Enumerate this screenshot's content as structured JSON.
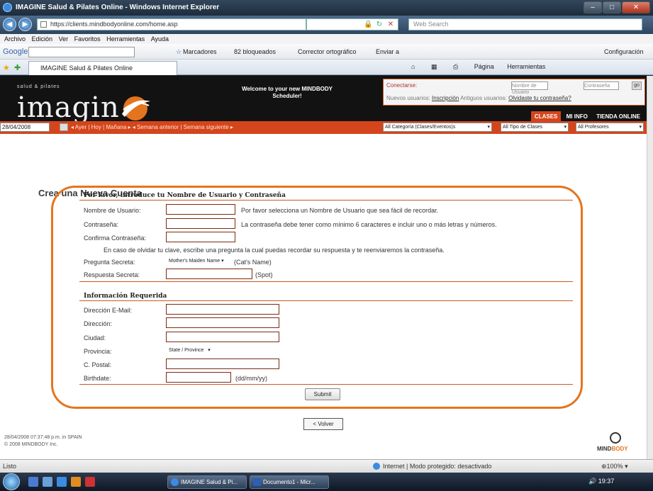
{
  "window": {
    "title": "IMAGINE Salud & Pilates Online - Windows Internet Explorer"
  },
  "address": {
    "url": "https://clients.mindbodyonline.com/home.asp",
    "search_placeholder": "Web Search"
  },
  "menu": [
    "Archivo",
    "Edición",
    "Ver",
    "Favoritos",
    "Herramientas",
    "Ayuda"
  ],
  "google_toolbar": {
    "logo": "Google",
    "marcadores": "Marcadores",
    "bloqueados": "82 bloqueados",
    "corrector": "Corrector ortográfico",
    "enviar": "Enviar a",
    "configuracion": "Configuración"
  },
  "tab": {
    "title": "IMAGINE Salud & Pilates Online",
    "tools": [
      "Página",
      "Herramientas"
    ]
  },
  "site": {
    "brand_small": "salud & pilates",
    "brand": "imagin",
    "welcome": "Welcome to your new MINDBODY Scheduler!",
    "login_label": "Conectarse:",
    "user_placeholder": "Nombre de Usuario",
    "pass_placeholder": "Contraseña",
    "go": "go",
    "new_users": "Nuevos usuarios:",
    "register": "Inscripción",
    "old_users": "Antiguos usuarios:",
    "forgot": "Olvidaste tu contraseña?",
    "nav": [
      "CLASES",
      "MI INFO",
      "TIENDA ONLINE"
    ],
    "date": "28/04/2008",
    "datenav": "◂ Ayer | Hoy | Mañana ▸  ◂ Semana anterior | Semana siguiente ▸",
    "filters": [
      "All Categoría (Clases/Eventos)s",
      "All Tipo de Clases",
      "All Profesores"
    ]
  },
  "form": {
    "title": "Crea una Nueva Cuenta",
    "section1": "Por favor, introduce tu Nombre de Usuario y Contraseña",
    "username_label": "Nombre de Usuario:",
    "username_help": "Por favor selecciona un Nombre de Usuario que sea fácil de recordar.",
    "password_label": "Contraseña:",
    "password_help": "La contraseña debe tener como mínimo 6 caracteres e incluir uno o más letras y números.",
    "confirm_label": "Confirma Contraseña:",
    "secret_note": "En caso de olvidar tu clave, escribe una pregunta la cual puedas recordar su respuesta y te reenviaremos la contraseña.",
    "question_label": "Pregunta Secreta:",
    "question_value": "Mother's Maiden Name",
    "question_hint": "(Cat's Name)",
    "answer_label": "Respuesta Secreta:",
    "answer_hint": "(Spot)",
    "section2": "Información Requerida",
    "email_label": "Dirección E-Mail:",
    "address_label": "Dirección:",
    "city_label": "Ciudad:",
    "province_label": "Provincia:",
    "province_value": "State / Province",
    "postal_label": "C. Postal:",
    "birth_label": "Birthdate:",
    "birth_hint": "(dd/mm/yy)",
    "submit": "Submit",
    "back": "< Volver"
  },
  "footer": {
    "line1": "28/04/2008 07:37:48 p.m. in SPAIN",
    "line2": "© 2008 MINDBODY Inc.",
    "logo_a": "MIND",
    "logo_b": "BODY"
  },
  "status": {
    "left": "Listo",
    "zone": "Internet | Modo protegido: desactivado",
    "zoom": "100%"
  },
  "taskbar": {
    "task1": "IMAGINE Salud & Pi...",
    "task2": "Documento1 - Micr...",
    "clock": "19:37"
  }
}
